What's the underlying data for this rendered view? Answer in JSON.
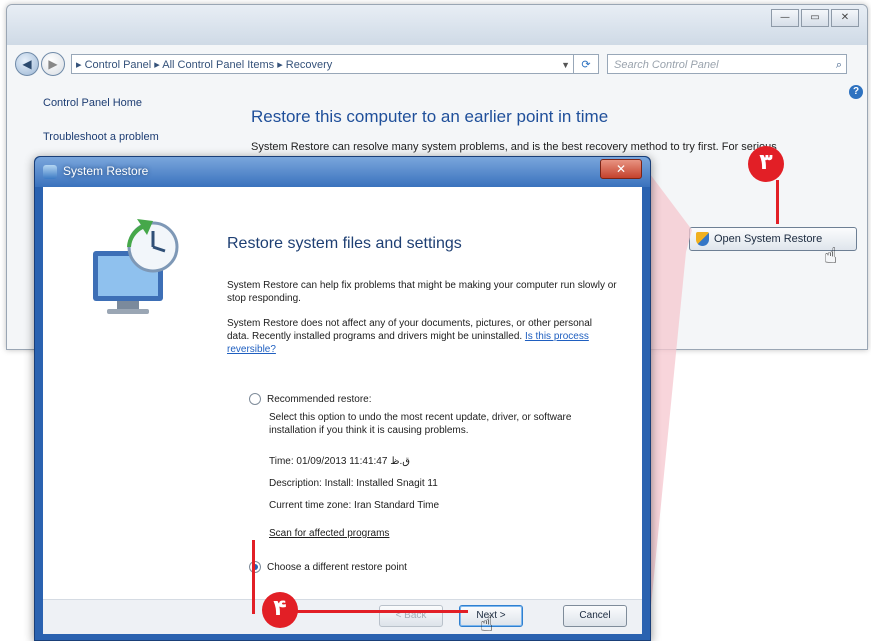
{
  "control_panel": {
    "window_buttons": [
      "—",
      "▭",
      "✕"
    ],
    "nav_back": "◀",
    "nav_forward": "▶",
    "address": "▸ Control Panel ▸ All Control Panel Items ▸ Recovery",
    "search_placeholder": "Search Control Panel",
    "sidebar": [
      "Control Panel Home",
      "Troubleshoot a problem"
    ],
    "title": "Restore this computer to an earlier point in time",
    "description": "System Restore can resolve many system problems, and is the best recovery method to try first. For serious",
    "open_system_restore": "Open System Restore"
  },
  "dialog": {
    "title": "System Restore",
    "close": "✕",
    "heading": "Restore system files and settings",
    "para1": "System Restore can help fix problems that might be making your computer run slowly or stop responding.",
    "para2": "System Restore does not affect any of your documents, pictures, or other personal data. Recently installed programs and drivers might be uninstalled.",
    "para2_link": "Is this process reversible?",
    "recommended_label": "Recommended restore:",
    "recommended_desc": "Select this option to undo the most recent update, driver, or software installation if you think it is causing problems.",
    "time": "Time: 01/09/2013 11:41:47 ق.ظ",
    "description": "Description: Install: Installed Snagit 11",
    "timezone": "Current time zone: Iran Standard Time",
    "scan_link": "Scan for affected programs",
    "choose_label": "Choose a different restore point",
    "btn_back": "< Back",
    "btn_next": "Next >",
    "btn_cancel": "Cancel"
  },
  "callouts": {
    "step3": "۳",
    "step4": "۴"
  },
  "colors": {
    "callout": "#e21f26",
    "dialog_frame": "#2a62b0",
    "title_blue": "#1f4f9a"
  }
}
